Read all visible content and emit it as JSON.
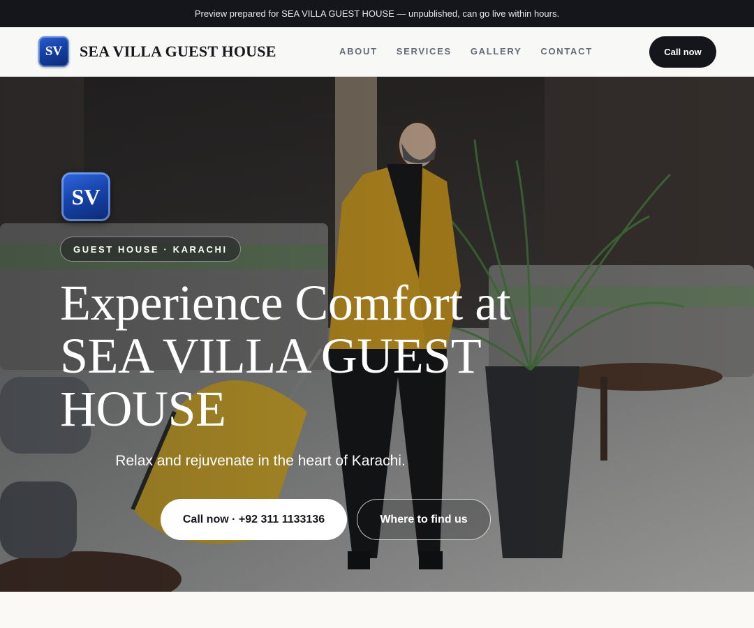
{
  "preview_banner": "Preview prepared for SEA VILLA GUEST HOUSE — unpublished, can go live within hours.",
  "header": {
    "logo_text": "SV",
    "brand_name": "SEA VILLA GUEST HOUSE",
    "nav": [
      "ABOUT",
      "SERVICES",
      "GALLERY",
      "CONTACT"
    ],
    "cta_label": "Call now"
  },
  "hero": {
    "logo_text": "SV",
    "eyebrow": "GUEST HOUSE · KARACHI",
    "title": "Experience Comfort at SEA VILLA GUEST HOUSE",
    "subtitle": "Relax and rejuvenate in the heart of Karachi.",
    "primary_button": "Call now · +92 311 1133136",
    "secondary_button": "Where to find us"
  },
  "colors": {
    "dark": "#14161b",
    "brand_blue": "#1541a4",
    "coat_yellow": "#d9a31d",
    "plant_green": "#3f7a3a",
    "page_bg": "#faf9f6"
  }
}
